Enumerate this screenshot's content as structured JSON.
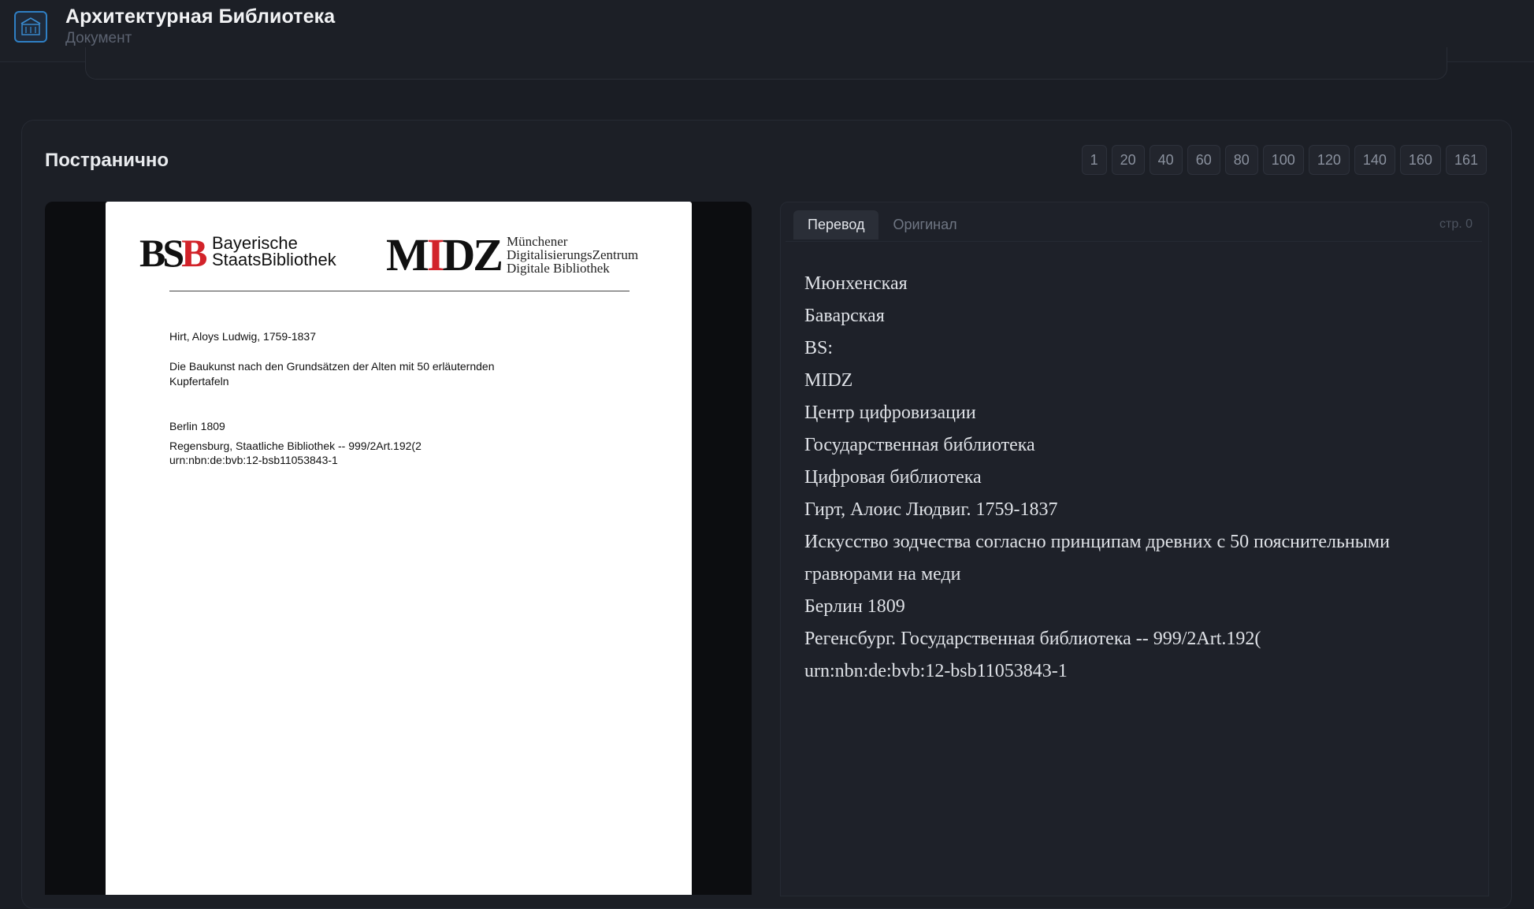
{
  "header": {
    "title": "Архитектурная Библиотека",
    "subtitle": "Документ",
    "logo_icon": "library-building-icon"
  },
  "section": {
    "title": "Постранично",
    "page_buttons": [
      "1",
      "20",
      "40",
      "60",
      "80",
      "100",
      "120",
      "140",
      "160",
      "161"
    ]
  },
  "document": {
    "bsb_mark_a": "BS",
    "bsb_mark_b": "B",
    "bsb_name_line1": "Bayerische",
    "bsb_name_line2": "StaatsBibliothek",
    "midz_mark_a": "M",
    "midz_mark_b": "I",
    "midz_mark_c": "DZ",
    "midz_name_line1": "Münchener",
    "midz_name_line2": "DigitalisierungsZentrum",
    "midz_name_line3": "Digitale Bibliothek",
    "author": "Hirt, Aloys Ludwig, 1759-1837",
    "title_line1": "Die Baukunst nach den Grundsätzen der Alten mit 50 erläuternden",
    "title_line2": "Kupfertafeln",
    "place_year": "Berlin 1809",
    "holding": "Regensburg, Staatliche Bibliothek -- 999/2Art.192(2",
    "urn": "urn:nbn:de:bvb:12-bsb11053843-1"
  },
  "translation": {
    "tabs": [
      {
        "label": "Перевод",
        "active": true
      },
      {
        "label": "Оригинал",
        "active": false
      }
    ],
    "page_indicator": "стр. 0",
    "lines": [
      "Мюнхенская",
      "Баварская",
      "BS:",
      "MIDZ",
      "Центр цифровизации",
      "Государственная библиотека",
      "Цифровая библиотека",
      "Гирт, Алоис Людвиг. 1759-1837",
      "Искусство зодчества согласно принципам древних с 50 пояснительными",
      "гравюрами на меди",
      "Берлин 1809",
      "Регенсбург. Государственная библиотека -- 999/2Art.192(",
      "urn:nbn:de:bvb:12-bsb11053843-1"
    ]
  },
  "colors": {
    "background": "#1a1d24",
    "accent": "#2f7fc4",
    "logo_red": "#d2232a"
  }
}
